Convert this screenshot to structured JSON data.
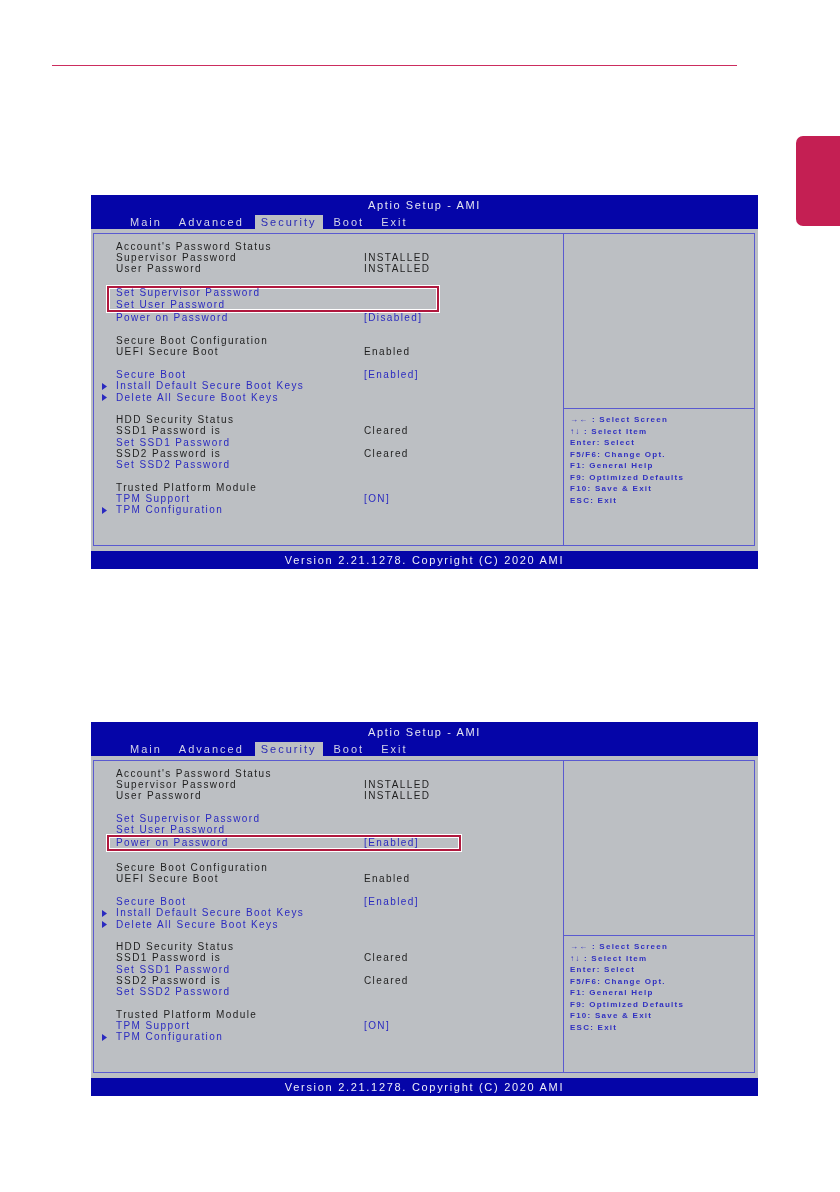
{
  "screenshots": [
    {
      "title": "Aptio Setup - AMI",
      "tabs": [
        {
          "label": "Main",
          "selected": false
        },
        {
          "label": "Advanced",
          "selected": false
        },
        {
          "label": "Security",
          "selected": true
        },
        {
          "label": "Boot",
          "selected": false
        },
        {
          "label": "Exit",
          "selected": false
        }
      ],
      "rows": [
        {
          "kind": "status",
          "label": "Account's Password Status"
        },
        {
          "kind": "status",
          "label": "Supervisor Password",
          "value": "INSTALLED"
        },
        {
          "kind": "status",
          "label": "User Password",
          "value": "INSTALLED"
        },
        {
          "kind": "gap"
        },
        {
          "kind": "callout",
          "rows": [
            {
              "kind": "option",
              "label": "Set Supervisor Password"
            },
            {
              "kind": "option",
              "label": "Set User Password"
            }
          ]
        },
        {
          "kind": "option",
          "label": "Power on Password",
          "value": "[Disabled]"
        },
        {
          "kind": "gap"
        },
        {
          "kind": "status",
          "label": "Secure Boot Configuration"
        },
        {
          "kind": "status",
          "label": "UEFI Secure Boot",
          "value": "Enabled"
        },
        {
          "kind": "gap"
        },
        {
          "kind": "option",
          "label": "Secure Boot",
          "value": "[Enabled]"
        },
        {
          "kind": "submenu",
          "label": "Install Default Secure Boot Keys"
        },
        {
          "kind": "submenu",
          "label": "Delete All Secure Boot Keys"
        },
        {
          "kind": "gap"
        },
        {
          "kind": "status",
          "label": "HDD Security Status"
        },
        {
          "kind": "status",
          "label": "SSD1 Password is",
          "value": "Cleared"
        },
        {
          "kind": "option",
          "label": "Set SSD1 Password"
        },
        {
          "kind": "status",
          "label": "SSD2 Password is",
          "value": "Cleared"
        },
        {
          "kind": "option",
          "label": "Set SSD2 Password"
        },
        {
          "kind": "gap"
        },
        {
          "kind": "status",
          "label": "Trusted Platform Module"
        },
        {
          "kind": "option",
          "label": "TPM Support",
          "value": "[ON]"
        },
        {
          "kind": "submenu",
          "label": "TPM Configuration"
        }
      ],
      "help_keys": [
        "→← : Select Screen",
        "↑↓ : Select Item",
        "Enter: Select",
        "F5/F6: Change Opt.",
        "F1: General Help",
        "F9: Optimized Defaults",
        "F10: Save & Exit",
        "ESC: Exit"
      ],
      "footer": "Version 2.21.1278. Copyright (C) 2020 AMI"
    },
    {
      "title": "Aptio Setup - AMI",
      "tabs": [
        {
          "label": "Main",
          "selected": false
        },
        {
          "label": "Advanced",
          "selected": false
        },
        {
          "label": "Security",
          "selected": true
        },
        {
          "label": "Boot",
          "selected": false
        },
        {
          "label": "Exit",
          "selected": false
        }
      ],
      "rows": [
        {
          "kind": "status",
          "label": "Account's Password Status"
        },
        {
          "kind": "status",
          "label": "Supervisor Password",
          "value": "INSTALLED"
        },
        {
          "kind": "status",
          "label": "User Password",
          "value": "INSTALLED"
        },
        {
          "kind": "gap"
        },
        {
          "kind": "option",
          "label": "Set Supervisor Password"
        },
        {
          "kind": "option",
          "label": "Set User Password"
        },
        {
          "kind": "callout",
          "rows": [
            {
              "kind": "option",
              "label": "Power on Password",
              "value": "[Enabled]"
            }
          ]
        },
        {
          "kind": "gap"
        },
        {
          "kind": "status",
          "label": "Secure Boot Configuration"
        },
        {
          "kind": "status",
          "label": "UEFI Secure Boot",
          "value": "Enabled"
        },
        {
          "kind": "gap"
        },
        {
          "kind": "option",
          "label": "Secure Boot",
          "value": "[Enabled]"
        },
        {
          "kind": "submenu",
          "label": "Install Default Secure Boot Keys"
        },
        {
          "kind": "submenu",
          "label": "Delete All Secure Boot Keys"
        },
        {
          "kind": "gap"
        },
        {
          "kind": "status",
          "label": "HDD Security Status"
        },
        {
          "kind": "status",
          "label": "SSD1 Password is",
          "value": "Cleared"
        },
        {
          "kind": "option",
          "label": "Set SSD1 Password"
        },
        {
          "kind": "status",
          "label": "SSD2 Password is",
          "value": "Cleared"
        },
        {
          "kind": "option",
          "label": "Set SSD2 Password"
        },
        {
          "kind": "gap"
        },
        {
          "kind": "status",
          "label": "Trusted Platform Module"
        },
        {
          "kind": "option",
          "label": "TPM Support",
          "value": "[ON]"
        },
        {
          "kind": "submenu",
          "label": "TPM Configuration"
        }
      ],
      "help_keys": [
        "→← : Select Screen",
        "↑↓ : Select Item",
        "Enter: Select",
        "F5/F6: Change Opt.",
        "F1: General Help",
        "F9: Optimized Defaults",
        "F10: Save & Exit",
        "ESC: Exit"
      ],
      "footer": "Version 2.21.1278. Copyright (C) 2020 AMI"
    }
  ]
}
